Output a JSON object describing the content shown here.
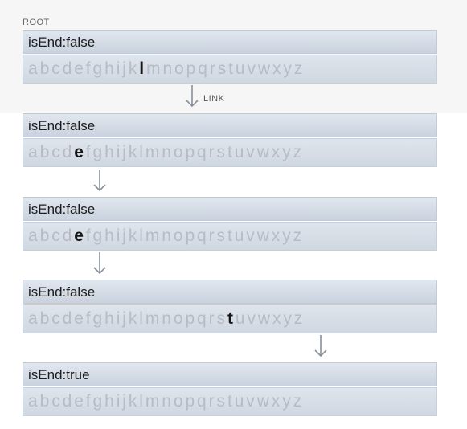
{
  "root_label": "ROOT",
  "link_label": "LINK",
  "alphabet": "abcdefghijklmnopqrstuvwxyz",
  "nodes": [
    {
      "header": "isEnd:false",
      "highlight": "l"
    },
    {
      "header": "isEnd:false",
      "highlight": "e"
    },
    {
      "header": "isEnd:false",
      "highlight": "e"
    },
    {
      "header": "isEnd:false",
      "highlight": "t"
    },
    {
      "header": "isEnd:true",
      "highlight": ""
    }
  ],
  "colors": {
    "letter_dim": "#b5bcc6",
    "letter_active": "#151515",
    "arrow": "#888f99"
  }
}
